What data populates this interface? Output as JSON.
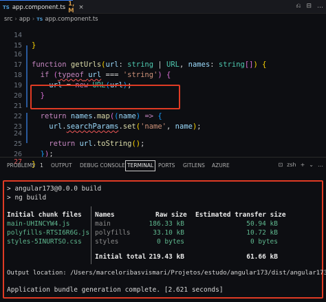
{
  "tab": {
    "icon": "TS",
    "title": "app.component.ts",
    "meta": "1, M",
    "close": "×"
  },
  "tab_actions": [
    "⎌",
    "⊟",
    "…"
  ],
  "breadcrumb": {
    "items": [
      "src",
      "app"
    ],
    "file_icon": "TS",
    "file": "app.component.ts"
  },
  "code": {
    "lines": [
      {
        "n": "14",
        "text": "}"
      },
      {
        "n": "15",
        "text": ""
      },
      {
        "n": "16",
        "text": "function getUrls(url: string | URL, names: string[]) {"
      },
      {
        "n": "17",
        "text": "  if (typeof url === 'string') {"
      },
      {
        "n": "18",
        "text": "    url = new URL(url);"
      },
      {
        "n": "19",
        "text": "  }"
      },
      {
        "n": "20",
        "text": ""
      },
      {
        "n": "21",
        "text": "  return names.map((name) => {"
      },
      {
        "n": "22",
        "text": "    url.searchParams.set('name', name);"
      },
      {
        "n": "23",
        "text": ""
      },
      {
        "n": "24",
        "text": "    return url.toString();"
      },
      {
        "n": "25",
        "text": "  });"
      },
      {
        "n": "26",
        "text": "}"
      },
      {
        "n": "27",
        "text": ""
      }
    ]
  },
  "panel": {
    "tabs": [
      {
        "label": "PROBLEMS",
        "count": "1"
      },
      {
        "label": "OUTPUT"
      },
      {
        "label": "DEBUG CONSOLE"
      },
      {
        "label": "TERMINAL",
        "active": true
      },
      {
        "label": "PORTS"
      },
      {
        "label": "GITLENS"
      },
      {
        "label": "AZURE"
      }
    ],
    "actions": {
      "shell": "zsh",
      "add": "+",
      "split": "⌄",
      "more": "…"
    }
  },
  "terminal": {
    "cmd1": "> angular173@0.0.0 build",
    "cmd2": "> ng build",
    "headers": {
      "files": "Initial chunk files",
      "names": "Names",
      "raw": "Raw size",
      "transfer": "Estimated transfer size"
    },
    "rows": [
      {
        "file": "main-UHINCYW4.js",
        "name": "main",
        "raw": "186.33 kB",
        "transfer": "50.94 kB"
      },
      {
        "file": "polyfills-RTSI6R6G.js",
        "name": "polyfills",
        "raw": "33.10 kB",
        "transfer": "10.72 kB"
      },
      {
        "file": "styles-5INURTSO.css",
        "name": "styles",
        "raw": "0 bytes",
        "transfer": "0 bytes"
      }
    ],
    "total": {
      "label": "Initial total",
      "raw": "219.43 kB",
      "transfer": "61.66 kB"
    },
    "output": "Output location: /Users/marceloribasvismari/Projetos/estudo/angular173/dist/angular173",
    "complete": "Application bundle generation complete. [2.621 seconds]"
  },
  "colors": {
    "highlight_border": "#e03b24",
    "accent": "#3b82f6"
  }
}
